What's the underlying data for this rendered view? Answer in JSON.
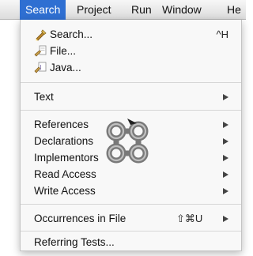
{
  "menubar": {
    "items": [
      "Search",
      "Project",
      "Run",
      "Window",
      "He"
    ]
  },
  "menu": {
    "search": {
      "label": "Search...",
      "shortcut": "^H",
      "icon": "search-flashlight-icon"
    },
    "file": {
      "label": "File...",
      "icon": "file-search-icon"
    },
    "java": {
      "label": "Java...",
      "icon": "java-search-icon"
    },
    "text": {
      "label": "Text"
    },
    "references": {
      "label": "References"
    },
    "declarations": {
      "label": "Declarations"
    },
    "implementors": {
      "label": "Implementors"
    },
    "read_access": {
      "label": "Read Access"
    },
    "write_access": {
      "label": "Write Access"
    },
    "occurrences": {
      "label": "Occurrences in File",
      "shortcut": "⇧⌘U"
    },
    "referring_tests": {
      "label": "Referring Tests..."
    }
  },
  "overlay": {
    "icon": "command-key-cursor-icon"
  },
  "colors": {
    "accent": "#2f6fd2",
    "menu_bg": "#f8f8f8",
    "separator": "#d6d6d6"
  }
}
